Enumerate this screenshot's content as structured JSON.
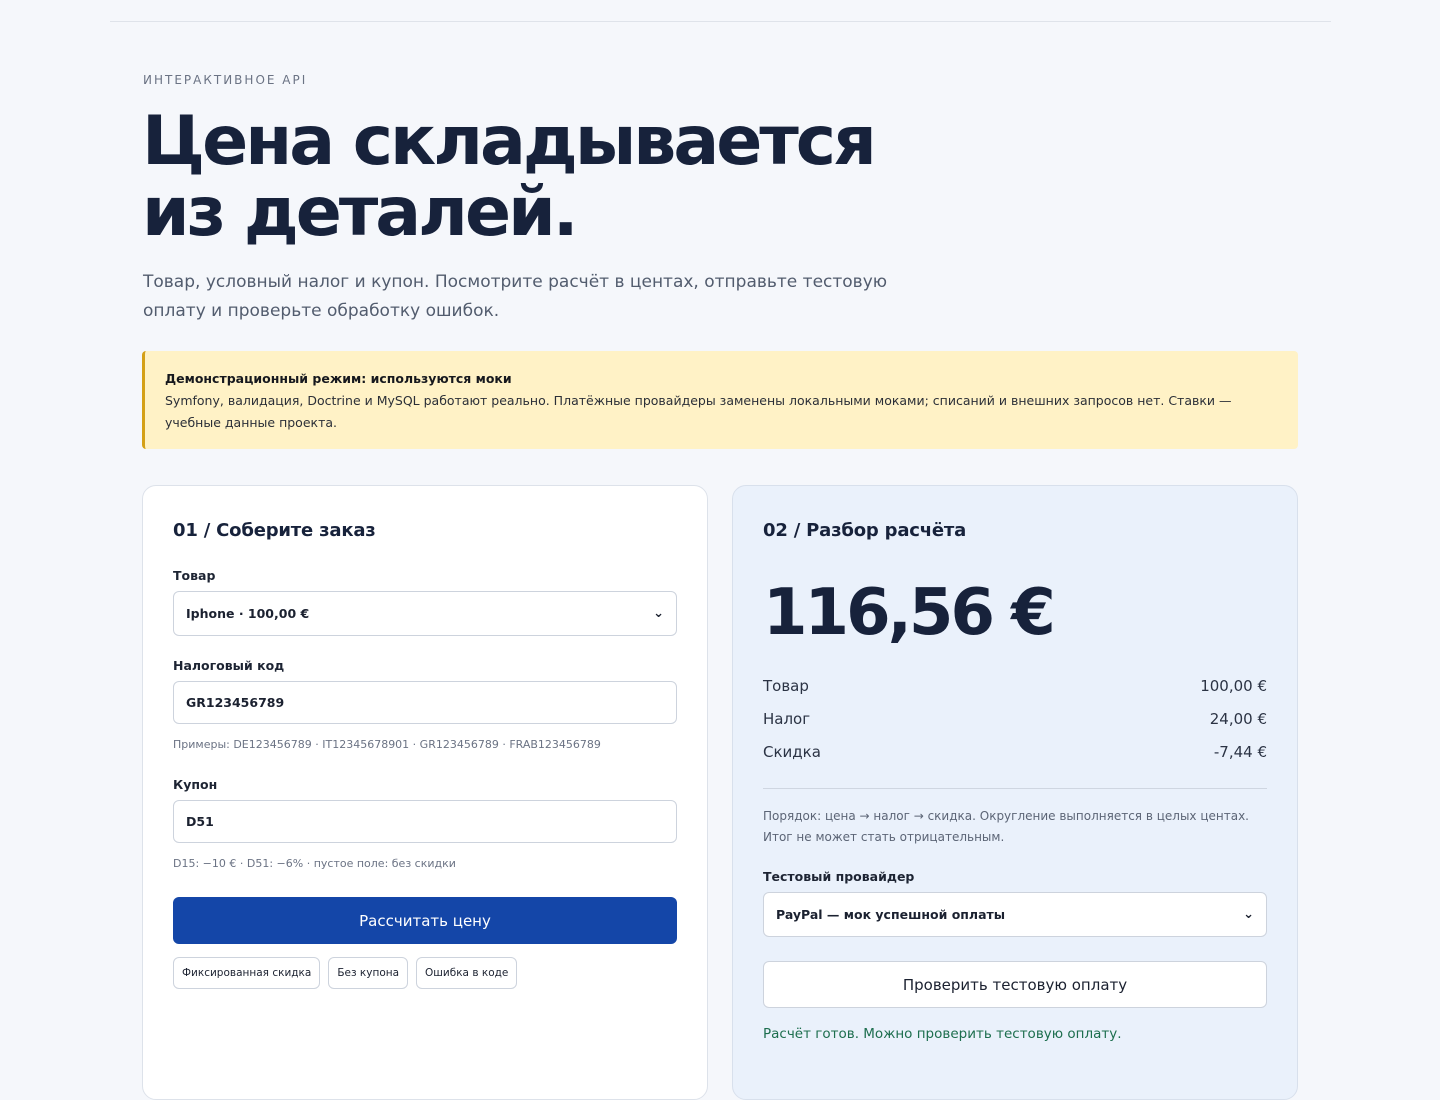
{
  "header": {
    "eyebrow": "ИНТЕРАКТИВНОЕ API",
    "title_line1": "Цена складывается",
    "title_line2": "из деталей.",
    "lede": "Товар, условный налог и купон. Посмотрите расчёт в центах, отправьте тестовую оплату и проверьте обработку ошибок."
  },
  "notice": {
    "title": "Демонстрационный режим: используются моки",
    "body": "Symfony, валидация, Doctrine и MySQL работают реально. Платёжные провайдеры заменены локальными моками; списаний и внешних запросов нет. Ставки — учебные данные проекта."
  },
  "order": {
    "heading": "01 / Соберите заказ",
    "product_label": "Товар",
    "product_value": "Iphone · 100,00 €",
    "tax_label": "Налоговый код",
    "tax_value": "GR123456789",
    "tax_hint": "Примеры: DE123456789 · IT12345678901 · GR123456789 · FRAB123456789",
    "coupon_label": "Купон",
    "coupon_value": "D51",
    "coupon_hint": "D15: −10 € · D51: −6% · пустое поле: без скидки",
    "calculate_label": "Рассчитать цену",
    "presets": [
      "Фиксированная скидка",
      "Без купона",
      "Ошибка в коде"
    ]
  },
  "breakdown": {
    "heading": "02 / Разбор расчёта",
    "total": "116,56 €",
    "rows": [
      {
        "label": "Товар",
        "value": "100,00 €"
      },
      {
        "label": "Налог",
        "value": "24,00 €"
      },
      {
        "label": "Скидка",
        "value": "-7,44 €"
      }
    ],
    "note": "Порядок: цена → налог → скидка. Округление выполняется в целых центах. Итог не может стать отрицательным.",
    "provider_label": "Тестовый провайдер",
    "provider_value": "PayPal — мок успешной оплаты",
    "check_label": "Проверить тестовую оплату",
    "status": "Расчёт готов. Можно проверить тестовую оплату."
  },
  "colors": {
    "primary": "#1446a8",
    "notice_bg": "#fff2c6",
    "notice_border": "#d4a017",
    "status_green": "#1d6e4e",
    "right_panel_bg": "#eaf1fb"
  },
  "icons": {
    "select_chevron": "chevron-down-icon"
  }
}
